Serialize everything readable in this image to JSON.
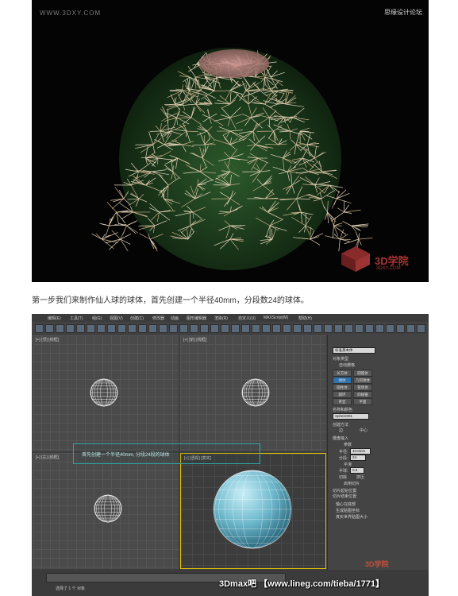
{
  "render_image": {
    "watermark_left": "WWW.3DXY.COM",
    "watermark_right": "思缘设计论坛",
    "brand_logo": "3D学院",
    "brand_logo_sub": "3DXY.COM"
  },
  "caption": "第一步我们来制作仙人球的球体，首先创建一个半径40mm，分段数24的球体。",
  "max_ui": {
    "menu": [
      "编辑(E)",
      "工具(T)",
      "组(G)",
      "视图(V)",
      "创建(C)",
      "修改器",
      "动画",
      "图形编辑器",
      "渲染(R)",
      "自定义(U)",
      "MAXScript(M)",
      "帮助(H)"
    ],
    "viewport_labels": [
      "[+] [顶] [线框]",
      "[+] [前] [线框]",
      "[+] [左] [线框]",
      "[+] [透视] [真实]"
    ],
    "tooltip": "首先创建一个半径40mm, 分段24段的球体",
    "command_panel": {
      "category": "标准基本体",
      "rollout_object_type": "对象类型",
      "autogrid": "自动栅格",
      "objects": [
        "长方体",
        "圆锥体",
        "球体",
        "几何球体",
        "圆柱体",
        "管状体",
        "圆环",
        "四棱锥",
        "茶壶",
        "平面"
      ],
      "selected_object": "球体",
      "rollout_name_color": "名称和颜色",
      "object_name": "Sphere001",
      "rollout_creation": "创建方法",
      "creation_methods": [
        "边",
        "中心"
      ],
      "rollout_keyboard": "键盘输入",
      "rollout_params": "参数",
      "radius_label": "半径:",
      "radius_value": "40.0mm",
      "segments_label": "分段:",
      "segments_value": "24",
      "smooth": "平滑",
      "hemisphere_label": "半球:",
      "hemisphere_value": "0.0",
      "chop": "切除",
      "squash": "挤压",
      "slice_on": "启用切片",
      "slice_from": "切片起始位置:",
      "slice_to": "切片结束位置:",
      "base_to_pivot": "轴心在底部",
      "gen_mapping": "生成贴图坐标",
      "real_world": "真实世界贴图大小"
    },
    "status": "选择了 1 个 对象"
  },
  "bottom_watermark": "3Dmax吧 【www.lineg.com/tieba/1771】",
  "tieba_mark": "3D学院"
}
